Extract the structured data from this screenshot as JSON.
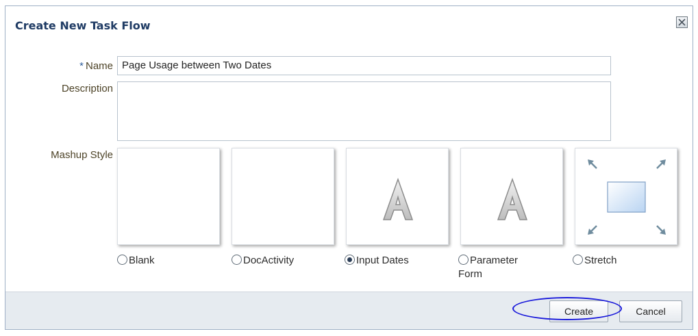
{
  "dialog": {
    "title": "Create New Task Flow",
    "close_icon": "close-x-icon"
  },
  "form": {
    "name": {
      "required_marker": "*",
      "label": "Name",
      "value": "Page Usage between Two Dates"
    },
    "description": {
      "label": "Description",
      "value": ""
    },
    "mashup_style": {
      "label": "Mashup Style",
      "selected": "Input Dates",
      "options": [
        {
          "label": "Blank",
          "preview": "blank-preview",
          "checked": false
        },
        {
          "label": "DocActivity",
          "preview": "blank-preview",
          "checked": false
        },
        {
          "label": "Input Dates",
          "preview": "letter-a-icon",
          "checked": true
        },
        {
          "label": "Parameter Form",
          "label_line1": "Parameter",
          "label_line2": "Form",
          "preview": "letter-a-icon",
          "checked": false
        },
        {
          "label": "Stretch",
          "preview": "stretch-arrows-icon",
          "checked": false
        }
      ]
    }
  },
  "footer": {
    "create_label": "Create",
    "cancel_label": "Cancel",
    "annotation": "blue ellipse around Create button",
    "annotation_color": "#1a1adb"
  }
}
